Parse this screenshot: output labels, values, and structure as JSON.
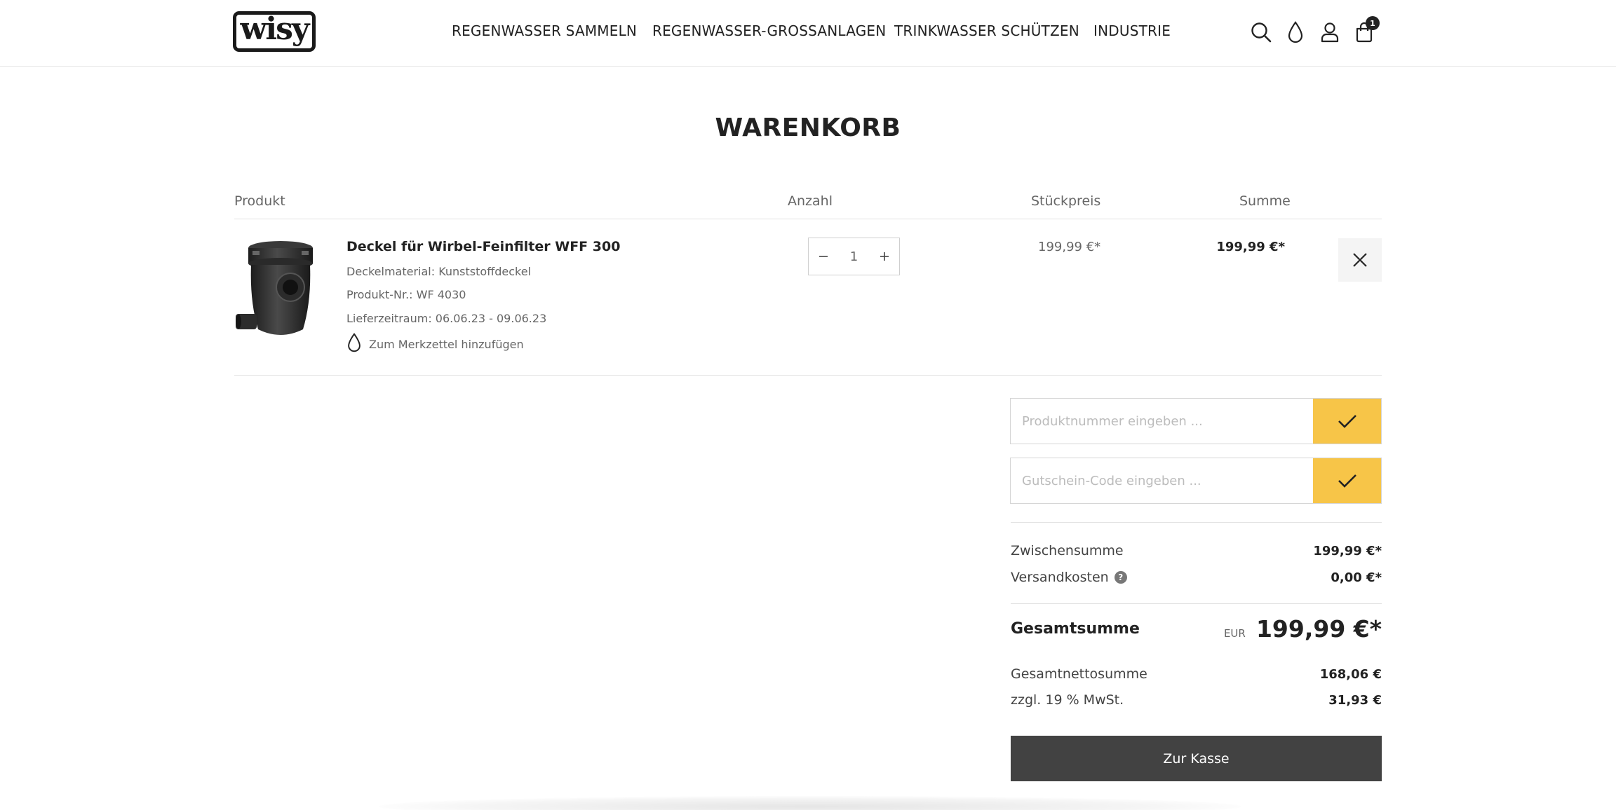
{
  "header": {
    "logo_text": "wisy",
    "nav": [
      "REGENWASSER SAMMELN",
      "REGENWASSER-GROSSANLAGEN",
      "TRINKWASSER SCHÜTZEN",
      "INDUSTRIE"
    ],
    "icons": [
      "search-icon",
      "drop-icon",
      "user-icon",
      "cart-icon"
    ],
    "cart_count": "1"
  },
  "page": {
    "title": "WARENKORB"
  },
  "table": {
    "headers": {
      "product": "Produkt",
      "quantity": "Anzahl",
      "unit_price": "Stückpreis",
      "sum": "Summe"
    }
  },
  "item": {
    "name": "Deckel für Wirbel-Feinfilter WFF 300",
    "meta": [
      "Deckelmaterial: Kunststoffdeckel",
      "Produkt-Nr.: WF 4030",
      "Lieferzeitraum: 06.06.23 - 09.06.23"
    ],
    "wishlist_label": "Zum Merkzettel hinzufügen",
    "quantity": "1",
    "unit_price": "199,99 €*",
    "line_total": "199,99 €*"
  },
  "forms": {
    "product_number_placeholder": "Produktnummer eingeben ...",
    "voucher_placeholder": "Gutschein-Code eingeben ..."
  },
  "summary": {
    "subtotal_label": "Zwischensumme",
    "subtotal": "199,99 €*",
    "shipping_label": "Versandkosten",
    "shipping": "0,00 €*",
    "total_label": "Gesamtsumme",
    "currency": "EUR",
    "total": "199,99 €*",
    "net_label": "Gesamtnettosumme",
    "net": "168,06 €",
    "tax_label": "zzgl. 19 % MwSt.",
    "tax": "31,93 €",
    "checkout_label": "Zur Kasse"
  },
  "colors": {
    "accent": "#f7c548",
    "checkout": "#424242",
    "text": "#222222"
  }
}
